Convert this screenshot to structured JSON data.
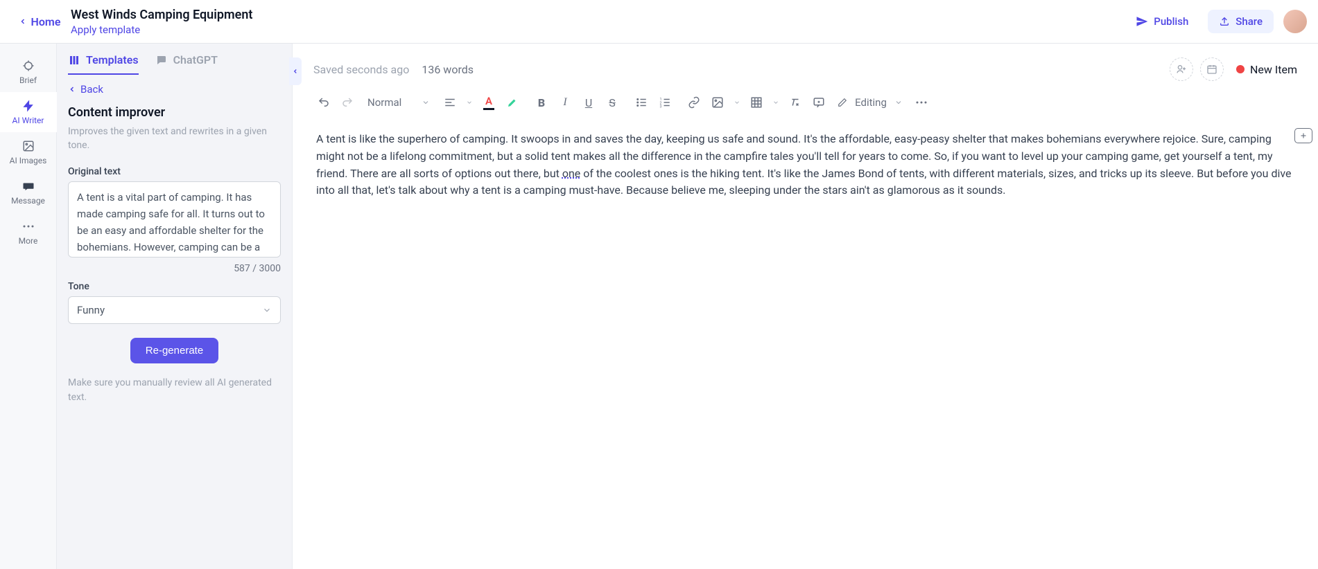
{
  "topbar": {
    "home_label": "Home",
    "title": "West Winds Camping Equipment",
    "apply_template_label": "Apply template",
    "publish_label": "Publish",
    "share_label": "Share"
  },
  "rail": {
    "brief": "Brief",
    "ai_writer": "AI Writer",
    "ai_images": "AI Images",
    "message": "Message",
    "more": "More"
  },
  "panel": {
    "tab_templates": "Templates",
    "tab_chatgpt": "ChatGPT",
    "back_label": "Back",
    "heading": "Content improver",
    "description": "Improves the given text and rewrites in a given tone.",
    "original_text_label": "Original text",
    "original_text_value": "A tent is a vital part of camping. It has made camping safe for all. It turns out to be an easy and affordable shelter for the bohemians. However, camping can be a",
    "char_count": "587 / 3000",
    "tone_label": "Tone",
    "tone_value": "Funny",
    "regenerate_label": "Re-generate",
    "review_note": "Make sure you manually review all AI generated text."
  },
  "editor": {
    "saved_status": "Saved seconds ago",
    "word_count": "136 words",
    "status_label": "New Item",
    "format_value": "Normal",
    "mode_value": "Editing",
    "body_pre": "A tent is like the superhero of camping. It swoops in and saves the day, keeping us safe and sound. It's the affordable, easy-peasy shelter that makes bohemians everywhere rejoice. Sure, camping might not be a lifelong commitment, but a solid tent makes all the difference in the campfire tales you'll tell for years to come. So, if you want to level up your camping game, get yourself a tent, my friend. There are all sorts of options out there, but ",
    "body_underlined": "one",
    "body_post": " of the coolest ones is the hiking tent. It's like the James Bond of tents, with different materials, sizes, and tricks up its sleeve. But before you dive into all that, let's talk about why a tent is a camping must-have. Because believe me, sleeping under the stars ain't as glamorous as it sounds."
  }
}
